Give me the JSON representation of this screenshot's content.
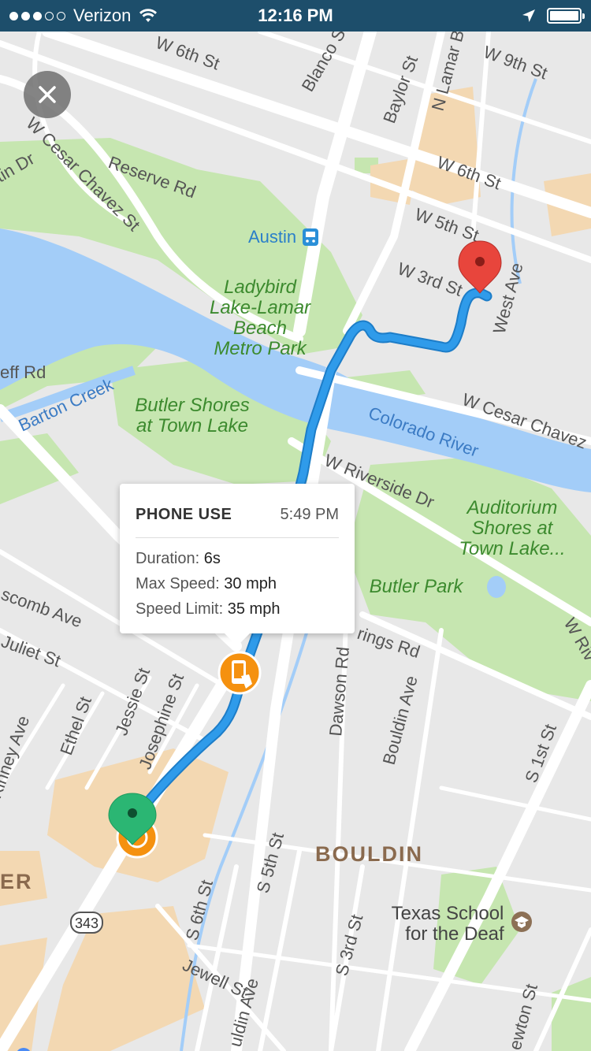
{
  "status_bar": {
    "carrier": "Verizon",
    "time": "12:16 PM",
    "signal_filled": 3,
    "signal_total": 5,
    "icons": [
      "wifi-icon",
      "location-arrow-icon",
      "battery-icon"
    ]
  },
  "map": {
    "labels": {
      "w6th_top": "W 6th St",
      "blanco": "Blanco St",
      "baylor": "Baylor St",
      "nlamar": "N Lamar Blvd",
      "w9th": "W 9th St",
      "w6th": "W 6th St",
      "w5th": "W 5th St",
      "w3rd": "W 3rd St",
      "west_ave": "West Ave",
      "cesar_left": "W Cesar Chavez St",
      "reserve": "Reserve Rd",
      "austin": "Austin",
      "park1": "Ladybird",
      "park2": "Lake-Lamar",
      "park3": "Beach",
      "park4": "Metro Park",
      "barton": "Barton Creek",
      "eff": "eff Rd",
      "butler1": "Butler Shores",
      "butler2": "at Town Lake",
      "colorado": "Colorado River",
      "cesar_right": "W Cesar Chavez",
      "riverside": "W Riverside Dr",
      "aud1": "Auditorium",
      "aud2": "Shores at",
      "aud3": "Town Lake...",
      "butler_park": "Butler Park",
      "springs": "rings Rd",
      "scomb": "scomb Ave",
      "juliet": "Juliet St",
      "jessie": "Jessie St",
      "josephine": "Josephine St",
      "ethel": "Ethel St",
      "kinney": "Kinney Ave",
      "dawson": "Dawson Rd",
      "bouldin_ave": "Bouldin Ave",
      "s1st": "S 1st St",
      "wriv": "W Riv",
      "bouldin": "BOULDIN",
      "er": "ER",
      "route": "343",
      "s5th": "S 5th St",
      "s6th": "S 6th St",
      "s3rd": "S 3rd St",
      "texas1": "Texas School",
      "texas2": "for the Deaf",
      "jewell": "Jewell St",
      "bouldin_ave2": "uldin Ave",
      "newton": "ewton St",
      "in_dr": "tin Dr"
    },
    "colors": {
      "route": "#2f9bea",
      "destination": "#e8453c",
      "start": "#2bb673",
      "event": "#f5910f",
      "water": "#a3cdf8",
      "park": "#c6e6b0"
    }
  },
  "close_button": {
    "icon": "close-icon"
  },
  "popup": {
    "title": "PHONE USE",
    "time": "5:49 PM",
    "duration_label": "Duration:",
    "duration_value": "6s",
    "max_speed_label": "Max Speed:",
    "max_speed_value": "30 mph",
    "speed_limit_label": "Speed Limit:",
    "speed_limit_value": "35 mph"
  }
}
